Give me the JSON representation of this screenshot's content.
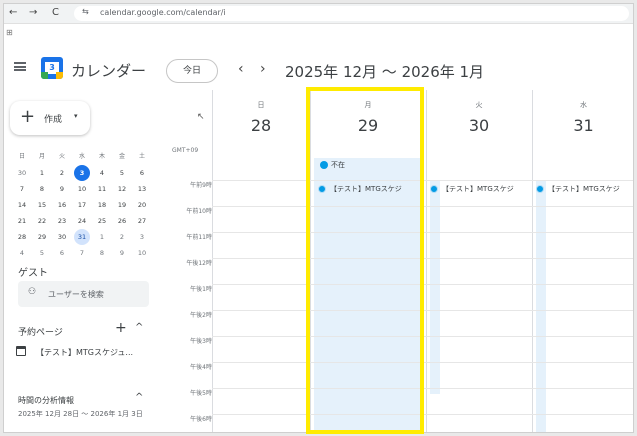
{
  "browser": {
    "back": "←",
    "forward": "→",
    "reload": "C",
    "site_icon": "⇆",
    "url": "calendar.google.com/calendar/i",
    "apps_icon": "⊞"
  },
  "header": {
    "logo_number": "3",
    "title": "カレンダー",
    "today_label": "今日",
    "prev": "‹",
    "next": "›",
    "period": "2025年 12月 〜 2026年 1月"
  },
  "sidebar": {
    "create_label": "作成",
    "create_plus": "+",
    "create_caret": "▾",
    "minical": {
      "weekdays": [
        "日",
        "月",
        "火",
        "水",
        "木",
        "金",
        "土"
      ],
      "weeks": [
        [
          "30",
          "1",
          "2",
          "3",
          "4",
          "5",
          "6"
        ],
        [
          "7",
          "8",
          "9",
          "10",
          "11",
          "12",
          "13"
        ],
        [
          "14",
          "15",
          "16",
          "17",
          "18",
          "19",
          "20"
        ],
        [
          "21",
          "22",
          "23",
          "24",
          "25",
          "26",
          "27"
        ],
        [
          "28",
          "29",
          "30",
          "31",
          "1",
          "2",
          "3"
        ],
        [
          "4",
          "5",
          "6",
          "7",
          "8",
          "9",
          "10"
        ]
      ]
    },
    "guest_label": "ゲスト",
    "guest_search_icon": "⚇",
    "guest_search_placeholder": "ユーザーを検索",
    "booking_label": "予約ページ",
    "booking_add": "+",
    "booking_collapse": "^",
    "booking_item": "【テスト】MTGスケジュ...",
    "analytics_label": "時間の分析情報",
    "analytics_collapse": "^",
    "analytics_range": "2025年 12月 28日 〜 2026年 1月 3日"
  },
  "grid": {
    "timezone": "GMT+09",
    "days": [
      {
        "dow": "日",
        "num": "28"
      },
      {
        "dow": "月",
        "num": "29"
      },
      {
        "dow": "火",
        "num": "30"
      },
      {
        "dow": "水",
        "num": "31"
      }
    ],
    "hours": [
      "午前9時",
      "午前10時",
      "午前11時",
      "午後12時",
      "午後1時",
      "午後2時",
      "午後3時",
      "午後4時",
      "午後5時",
      "午後6時"
    ],
    "allday_event": "不在",
    "event_title": "【テスト】MTGスケジ"
  },
  "colors": {
    "accent": "#1a73e8",
    "event": "#039be5",
    "highlight": "#ffeb00"
  }
}
